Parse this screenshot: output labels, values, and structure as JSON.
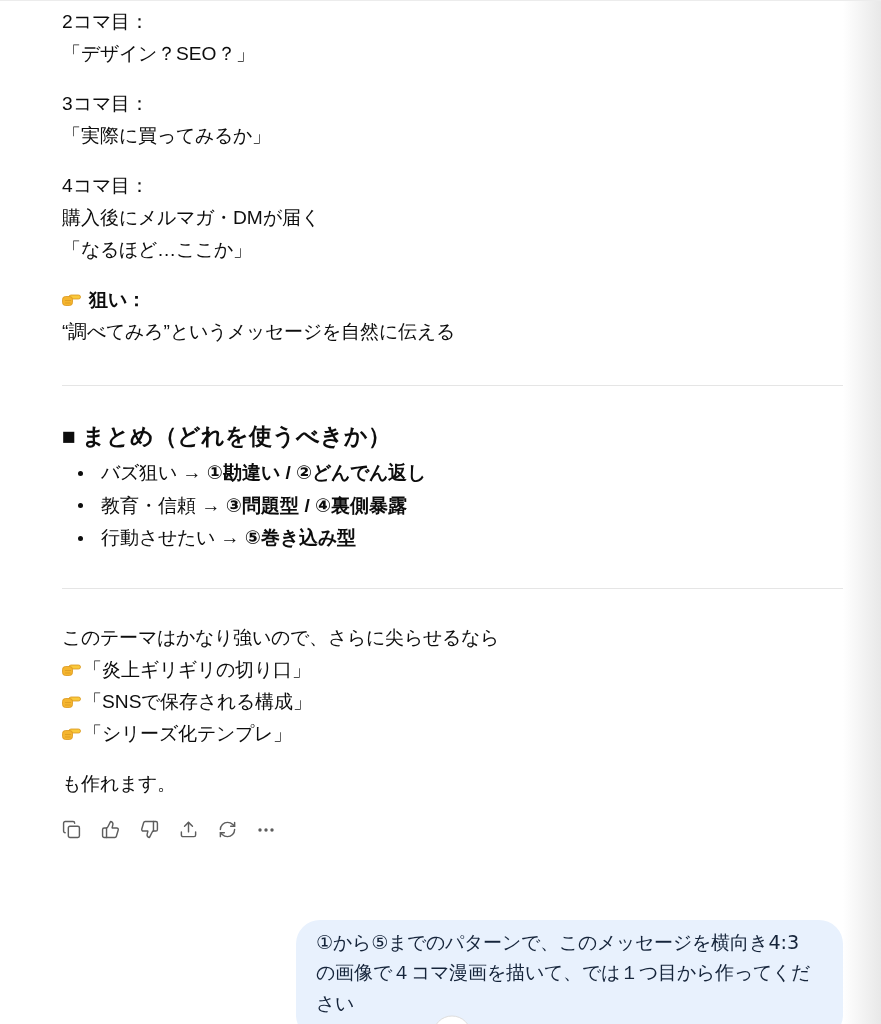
{
  "panels": [
    {
      "label": "2コマ目：",
      "lines": [
        "「デザイン？SEO？」"
      ]
    },
    {
      "label": "3コマ目：",
      "lines": [
        "「実際に買ってみるか」"
      ]
    },
    {
      "label": "4コマ目：",
      "lines": [
        "購入後にメルマガ・DMが届く",
        "「なるほど…ここか」"
      ]
    }
  ],
  "aim": {
    "label": "狙い：",
    "text": "“調べてみろ”というメッセージを自然に伝える"
  },
  "summary": {
    "heading": "■ まとめ（どれを使うべきか）",
    "items": [
      "バズ狙い → **①勘違い / ②どんでん返し**",
      "教育・信頼 → **③問題型 / ④裏側暴露**",
      "行動させたい → **⑤巻き込み型**"
    ]
  },
  "closing": {
    "intro": "このテーマはかなり強いので、さらに尖らせるなら",
    "suggestions": [
      "「炎上ギリギリの切り口」",
      "「SNSで保存される構成」",
      "「シリーズ化テンプレ」"
    ],
    "outro": "も作れます。"
  },
  "user_message": {
    "text": "①から⑤までのパターンで、このメッセージを横向き4:3の画像で４コマ漫画を描いて、では１つ目から作ってください"
  }
}
